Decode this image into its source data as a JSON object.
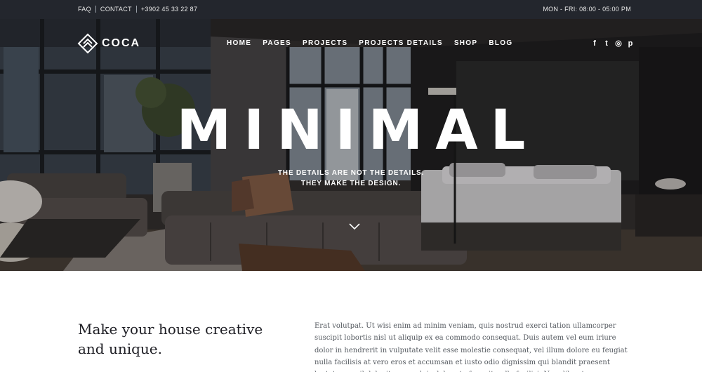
{
  "topbar": {
    "faq": "FAQ",
    "contact": "CONTACT",
    "phone": "+3902 45 33 22 87",
    "hours": "MON - FRI: 08:00 - 05:00 PM"
  },
  "brand": {
    "name": "COCA",
    "icon": "diamond-logo-icon"
  },
  "nav": {
    "items": [
      "HOME",
      "PAGES",
      "PROJECTS",
      "PROJECTS DETAILS",
      "SHOP",
      "BLOG"
    ]
  },
  "social": {
    "facebook": "f",
    "twitter": "t",
    "instagram": "◎",
    "pinterest": "p"
  },
  "hero": {
    "title": "MINIMAL",
    "subtitle_line1": "THE DETAILS ARE NOT THE DETAILS.",
    "subtitle_line2": "THEY MAKE THE DESIGN.",
    "scroll_icon": "chevron-down-icon"
  },
  "intro": {
    "heading": "Make your house creative and unique.",
    "body": "Erat volutpat. Ut wisi enim ad minim veniam, quis nostrud exerci tation ullamcorper suscipit lobortis nisl ut aliquip ex ea commodo consequat. Duis autem vel eum iriure dolor in hendrerit in vulputate velit esse molestie consequat, vel illum dolore eu feugiat nulla facilisis at vero eros et accumsan et iusto odio dignissim qui blandit praesent luptatum zzril delenit augue duis dolore te feugait nulla facilisi. Nam liber tempor"
  },
  "colors": {
    "topbar_bg": "#23262d",
    "hero_overlay": "#0a0a0c",
    "text_dark": "#1e1e24",
    "text_body": "#555a60"
  }
}
